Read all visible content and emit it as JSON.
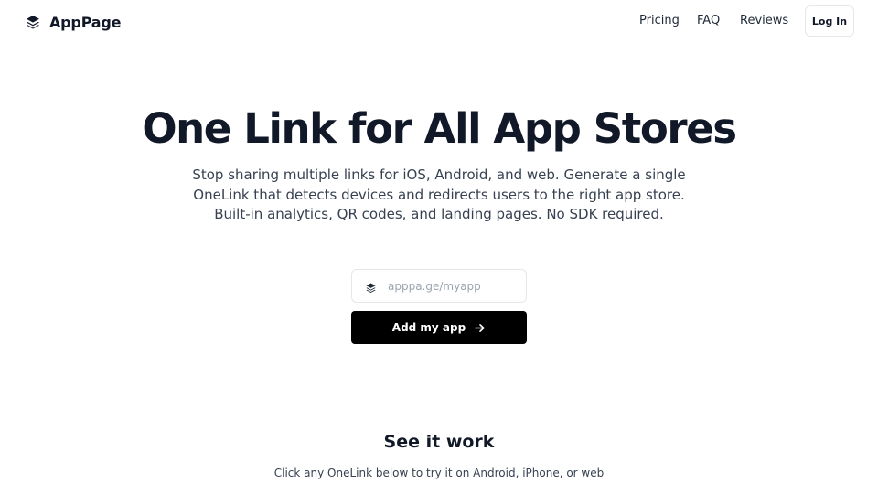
{
  "header": {
    "brand": "AppPage",
    "brand_icon": "stacked-layers-icon",
    "nav": {
      "pricing": "Pricing",
      "faq": "FAQ",
      "reviews": "Reviews"
    },
    "login_label": "Log In"
  },
  "hero": {
    "title": "One Link for All App Stores",
    "subtitle": "Stop sharing multiple links for iOS, Android, and web. Generate a single OneLink that detects devices and redirects users to the right app store. Built-in analytics, QR codes, and landing pages. No SDK required.",
    "input": {
      "placeholder": "apppa.ge/myapp",
      "value": "",
      "icon": "stacked-layers-icon"
    },
    "cta_label": "Add my app",
    "cta_icon": "arrow-right-icon"
  },
  "demo": {
    "title": "See it work",
    "subtitle": "Click any OneLink below to try it on Android, iPhone, or web"
  },
  "colors": {
    "text": "#111827",
    "button": "#000000",
    "border": "#e5e7eb",
    "placeholder": "#9ca3af"
  }
}
